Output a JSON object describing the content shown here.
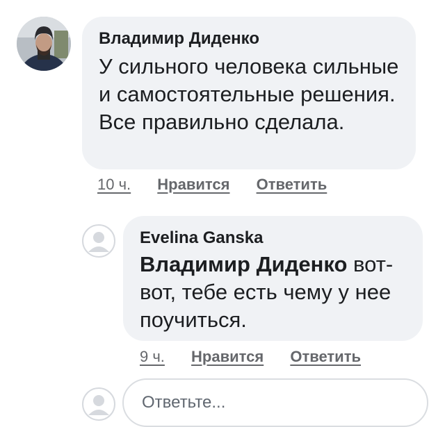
{
  "comment": {
    "author": "Владимир Диденко",
    "text": "У сильного человека сильные и самостоятельные решения. Все правильно сделала.",
    "time": "10 ч.",
    "like_label": "Нравится",
    "reply_label": "Ответить"
  },
  "reply": {
    "author": "Evelina Ganska",
    "mention": "Владимир Диденко",
    "text": "вот-вот, тебе есть чему у нее поучиться.",
    "time": "9 ч.",
    "like_label": "Нравится",
    "reply_label": "Ответить"
  },
  "reply_input": {
    "placeholder": "Ответьте..."
  },
  "icons": {
    "default_avatar": "person-silhouette-icon"
  },
  "colors": {
    "bubble_bg": "#f0f2f5",
    "text": "#1c1e21",
    "meta": "#65676b"
  }
}
